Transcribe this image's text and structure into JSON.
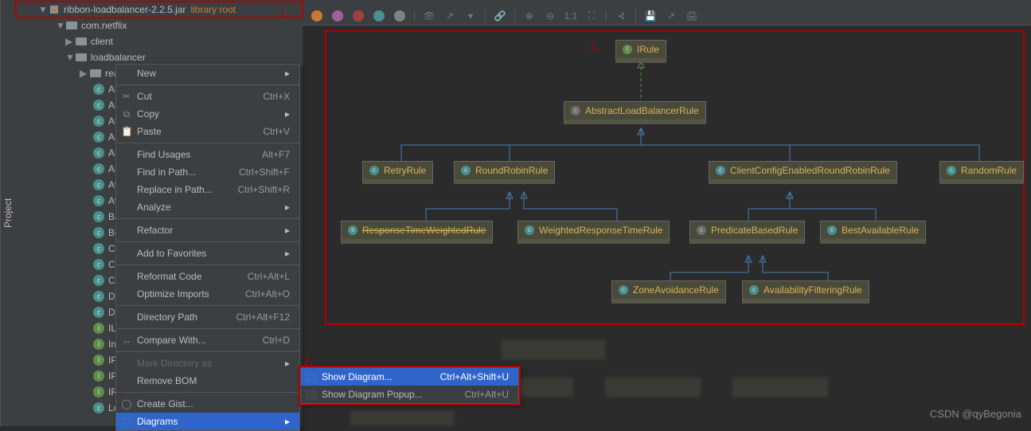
{
  "sidebar": {
    "tab": "Project"
  },
  "tree": {
    "jar": "ribbon-loadbalancer-2.2.5.jar",
    "lib_root": "library root",
    "pkg": "com.netflix",
    "folders": [
      "client",
      "loadbalancer",
      "reactive"
    ],
    "classes": [
      "Abs",
      "Abs",
      "Abs",
      "Abs",
      "Abs",
      "Abs",
      "Ava",
      "Ava",
      "Bas",
      "Bes",
      "Clie",
      "Cor",
      "Cor",
      "Dur",
      "Dyn",
      "ILoa",
      "Inte",
      "IPin",
      "IPingStrategy",
      "IRule",
      "LoadBalancerBuilder"
    ]
  },
  "menu": {
    "new": "New",
    "cut": "Cut",
    "cut_sc": "Ctrl+X",
    "copy": "Copy",
    "paste": "Paste",
    "paste_sc": "Ctrl+V",
    "find_usages": "Find Usages",
    "find_usages_sc": "Alt+F7",
    "find_in_path": "Find in Path...",
    "find_in_path_sc": "Ctrl+Shift+F",
    "replace_in_path": "Replace in Path...",
    "replace_in_path_sc": "Ctrl+Shift+R",
    "analyze": "Analyze",
    "refactor": "Refactor",
    "add_fav": "Add to Favorites",
    "reformat": "Reformat Code",
    "reformat_sc": "Ctrl+Alt+L",
    "optimize": "Optimize Imports",
    "optimize_sc": "Ctrl+Alt+O",
    "dir_path": "Directory Path",
    "dir_path_sc": "Ctrl+Alt+F12",
    "compare": "Compare With...",
    "compare_sc": "Ctrl+D",
    "mark_dir": "Mark Directory as",
    "remove_bom": "Remove BOM",
    "gist": "Create Gist...",
    "diagrams": "Diagrams"
  },
  "submenu": {
    "show": "Show Diagram...",
    "show_sc": "Ctrl+Alt+Shift+U",
    "popup": "Show Diagram Popup...",
    "popup_sc": "Ctrl+Alt+U"
  },
  "annotations": {
    "a1": "1、",
    "a2": "2、",
    "a3": "3、"
  },
  "diagram": {
    "nodes": {
      "irule": "IRule",
      "abstract": "AbstractLoadBalancerRule",
      "retry": "RetryRule",
      "round": "RoundRobinRule",
      "ccerr": "ClientConfigEnabledRoundRobinRule",
      "random": "RandomRule",
      "resptime": "ResponseTimeWeightedRule",
      "weighted": "WeightedResponseTimeRule",
      "predicate": "PredicateBasedRule",
      "best": "BestAvailableRule",
      "zone": "ZoneAvoidanceRule",
      "avail": "AvailabilityFilteringRule"
    }
  },
  "toolbar": {
    "zoom": "1:1"
  },
  "watermark": "CSDN @qyBegonia"
}
